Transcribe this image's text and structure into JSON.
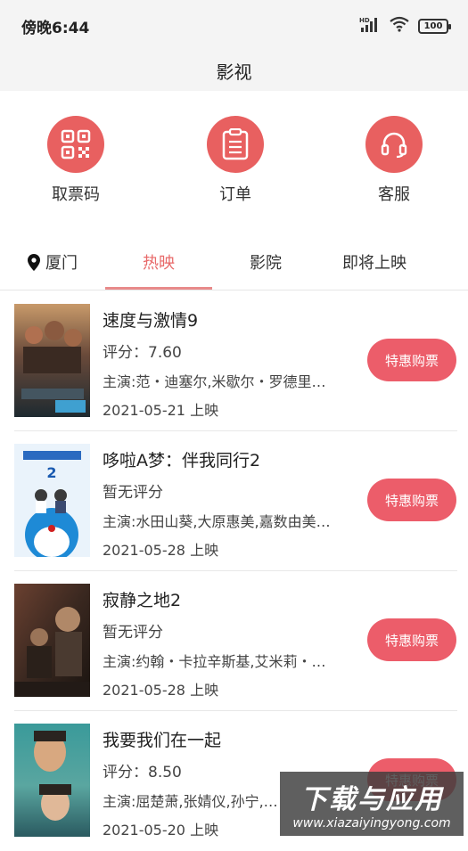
{
  "status_bar": {
    "time": "傍晚6:44",
    "network": "HD",
    "battery": "100"
  },
  "header": {
    "title": "影视"
  },
  "quick_actions": [
    {
      "label": "取票码",
      "icon": "qr-code-icon"
    },
    {
      "label": "订单",
      "icon": "order-list-icon"
    },
    {
      "label": "客服",
      "icon": "headset-icon"
    }
  ],
  "tabs": {
    "city": "厦门",
    "items": [
      {
        "label": "热映",
        "active": true
      },
      {
        "label": "影院",
        "active": false
      },
      {
        "label": "即将上映",
        "active": false
      }
    ]
  },
  "movies": [
    {
      "title": "速度与激情9",
      "score": "评分：7.60",
      "cast": "主演:范・迪塞尔,米歇尔・罗德里…",
      "date": "2021-05-21 上映",
      "button": "特惠购票"
    },
    {
      "title": "哆啦A梦：伴我同行2",
      "score": "暂无评分",
      "cast": "主演:水田山葵,大原惠美,嘉数由美…",
      "date": "2021-05-28 上映",
      "button": "特惠购票"
    },
    {
      "title": "寂静之地2",
      "score": "暂无评分",
      "cast": "主演:约翰・卡拉辛斯基,艾米莉・…",
      "date": "2021-05-28 上映",
      "button": "特惠购票"
    },
    {
      "title": "我要我们在一起",
      "score": "评分：8.50",
      "cast": "主演:屈楚萧,张婧仪,孙宁,…",
      "date": "2021-05-20 上映",
      "button": "特惠购票"
    }
  ],
  "watermark": {
    "text": "下载与应用",
    "url": "www.xiazaiyingyong.com"
  },
  "colors": {
    "accent": "#e86060",
    "button": "#ec5d6a",
    "active_tab": "#e86a6a",
    "background": "#f4f4f4"
  }
}
